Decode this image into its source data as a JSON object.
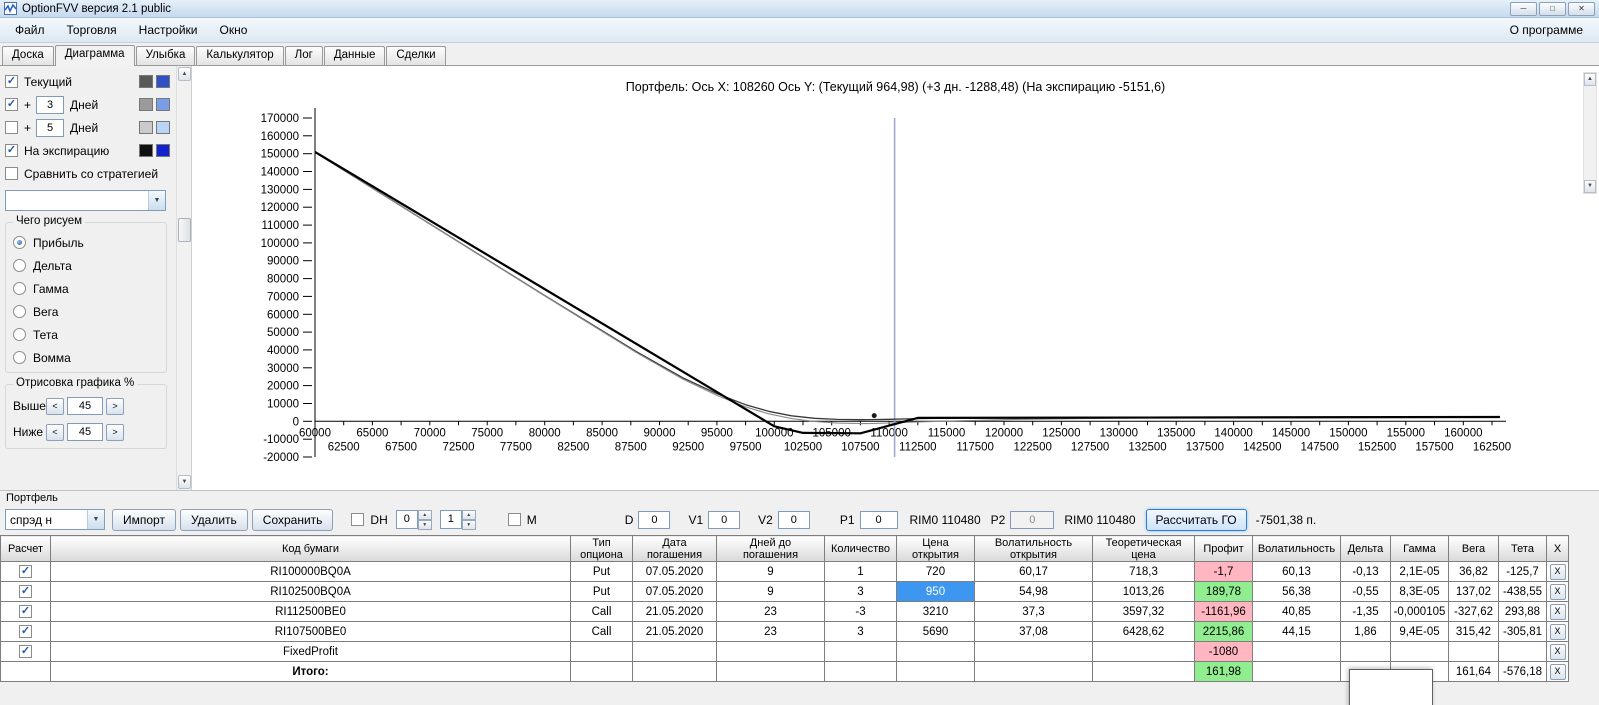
{
  "window": {
    "title": "OptionFVV версия 2.1 public",
    "buttons": {
      "minimize": "─",
      "maximize": "□",
      "close": "✕"
    }
  },
  "icons": {
    "up": "▲",
    "down": "▼",
    "dropdown": "▼"
  },
  "menu": {
    "items": [
      "Файл",
      "Торговля",
      "Настройки",
      "Окно"
    ],
    "right_item": "О программе"
  },
  "tabs": {
    "items": [
      "Доска",
      "Диаграмма",
      "Улыбка",
      "Калькулятор",
      "Лог",
      "Данные",
      "Сделки"
    ],
    "active_index": 1
  },
  "left_panel": {
    "series_rows": [
      {
        "label": "Текущий",
        "checked": true,
        "swatches": [
          "#595959",
          "#3050c8"
        ]
      },
      {
        "prefix": "+",
        "value": "3",
        "label": "Дней",
        "checked": true,
        "swatches": [
          "#9b9b9b",
          "#7a9de8"
        ]
      },
      {
        "prefix": "+",
        "value": "5",
        "label": "Дней",
        "checked": false,
        "swatches": [
          "#cacaca",
          "#b9d4f8"
        ]
      },
      {
        "label": "На экспирацию",
        "checked": true,
        "swatches": [
          "#101010",
          "#1322cf"
        ]
      }
    ],
    "compare_label": "Сравнить со стратегией",
    "compare_checked": false,
    "strategy_value": "",
    "draw_group": {
      "title": "Чего рисуем",
      "options": [
        "Прибыль",
        "Дельта",
        "Гамма",
        "Вега",
        "Тета",
        "Вомма"
      ],
      "selected": "Прибыль"
    },
    "render_group": {
      "title": "Отрисовка графика %",
      "rows": [
        {
          "label": "Выше",
          "value": "45"
        },
        {
          "label": "Ниже",
          "value": "45"
        }
      ],
      "dec_label": "<",
      "inc_label": ">"
    }
  },
  "chart": {
    "title": "Портфель: Ось X: 108260 Ось Y:  (Текущий 964,98)  (+3 дн. -1288,48)  (На экспирацию -5151,6)"
  },
  "chart_data": {
    "type": "line",
    "title": "Портфель",
    "xlabel": "",
    "ylabel": "",
    "xlim": [
      60000,
      163200
    ],
    "ylim": [
      -20000,
      170000
    ],
    "grid": false,
    "y_ticks": [
      170000,
      160000,
      150000,
      140000,
      130000,
      120000,
      110000,
      100000,
      90000,
      80000,
      70000,
      60000,
      50000,
      40000,
      30000,
      20000,
      10000,
      0,
      -10000,
      -20000
    ],
    "x_ticks_row1": [
      60000,
      65000,
      70000,
      75000,
      80000,
      85000,
      90000,
      95000,
      100000,
      105000,
      110000,
      115000,
      120000,
      125000,
      130000,
      135000,
      140000,
      145000,
      150000,
      155000,
      160000
    ],
    "x_ticks_row2": [
      62500,
      67500,
      72500,
      77500,
      82500,
      87500,
      92500,
      97500,
      102500,
      107500,
      112500,
      117500,
      122500,
      127500,
      132500,
      137500,
      142500,
      147500,
      152500,
      157500,
      162500
    ],
    "marker_x": 110480,
    "cursor_point": [
      108700,
      3200
    ],
    "readout": {
      "x": 108260,
      "current": "964,98",
      "plus3": "-1288,48",
      "expiration": "-5151,6"
    },
    "series": [
      {
        "name": "Текущий",
        "color": "#3a3a3a",
        "width": 1.3,
        "points": [
          [
            60000,
            150800
          ],
          [
            80000,
            70500
          ],
          [
            88000,
            39000
          ],
          [
            92000,
            24500
          ],
          [
            95000,
            15500
          ],
          [
            97500,
            9300
          ],
          [
            99500,
            5600
          ],
          [
            101500,
            3100
          ],
          [
            103500,
            1700
          ],
          [
            105500,
            1050
          ],
          [
            107500,
            900
          ],
          [
            108260,
            965
          ],
          [
            110000,
            1150
          ],
          [
            112500,
            1500
          ],
          [
            116000,
            1850
          ],
          [
            121000,
            2100
          ],
          [
            130000,
            2300
          ],
          [
            145000,
            2400
          ],
          [
            163200,
            2450
          ]
        ]
      },
      {
        "name": "+3 дн.",
        "color": "#8a8a8a",
        "width": 1.1,
        "points": [
          [
            60000,
            150900
          ],
          [
            80000,
            70300
          ],
          [
            88000,
            38500
          ],
          [
            92000,
            23800
          ],
          [
            95000,
            14500
          ],
          [
            97500,
            8100
          ],
          [
            99500,
            4200
          ],
          [
            101500,
            1500
          ],
          [
            103500,
            -100
          ],
          [
            105500,
            -1000
          ],
          [
            107500,
            -1300
          ],
          [
            108260,
            -1288
          ],
          [
            110000,
            -950
          ],
          [
            112500,
            -400
          ],
          [
            116000,
            300
          ],
          [
            121000,
            1100
          ],
          [
            130000,
            1800
          ],
          [
            145000,
            2200
          ],
          [
            163200,
            2350
          ]
        ]
      },
      {
        "name": "На экспирацию",
        "color": "#000000",
        "width": 2.2,
        "points": [
          [
            60000,
            151000
          ],
          [
            100000,
            -2800
          ],
          [
            102500,
            -6500
          ],
          [
            107500,
            -6700
          ],
          [
            112500,
            1900
          ],
          [
            163200,
            2400
          ]
        ]
      }
    ]
  },
  "portfolio": {
    "section_label": "Портфель",
    "combo_value": "спрэд н",
    "import_label": "Импорт",
    "delete_label": "Удалить",
    "save_label": "Сохранить",
    "dh_label": "DH",
    "spin_values": [
      "0",
      "1"
    ],
    "m_label": "M",
    "fields": [
      {
        "label": "D",
        "value": "0"
      },
      {
        "label": "V1",
        "value": "0"
      },
      {
        "label": "V2",
        "value": "0"
      },
      {
        "label": "P1",
        "value": "0"
      }
    ],
    "rim_label_1": "RIM0 110480",
    "p2_label": "P2",
    "p2_value": "0",
    "rim_label_2": "RIM0 110480",
    "calc_button": "Рассчитать ГО",
    "go_value": "-7501,38 п."
  },
  "table": {
    "headers": [
      "Расчет",
      "Код бумаги",
      "Тип\nопциона",
      "Дата\nпогашения",
      "Дней до\nпогашения",
      "Количество",
      "Цена\nоткрытия",
      "Волатильность\nоткрытия",
      "Теоретическая\nцена",
      "Профит",
      "Волатильность",
      "Дельта",
      "Гамма",
      "Вега",
      "Тета",
      "X"
    ],
    "delete_label": "X",
    "rows": [
      {
        "checked": true,
        "code": "RI100000BQ0A",
        "type": "Put",
        "date": "07.05.2020",
        "days": "9",
        "qty": "1",
        "price": "720",
        "vol_open": "60,17",
        "theor": "718,3",
        "profit": "-1,7",
        "profit_state": "neg",
        "vol": "60,13",
        "delta": "-0,13",
        "gamma": "2,1E-05",
        "vega": "36,82",
        "theta": "-125,7"
      },
      {
        "checked": true,
        "code": "RI102500BQ0A",
        "type": "Put",
        "date": "07.05.2020",
        "days": "9",
        "qty": "3",
        "price": "950",
        "price_selected": true,
        "vol_open": "54,98",
        "theor": "1013,26",
        "profit": "189,78",
        "profit_state": "pos",
        "vol": "56,38",
        "delta": "-0,55",
        "gamma": "8,3E-05",
        "vega": "137,02",
        "theta": "-438,55"
      },
      {
        "checked": true,
        "code": "RI112500BE0",
        "type": "Call",
        "date": "21.05.2020",
        "days": "23",
        "qty": "-3",
        "price": "3210",
        "vol_open": "37,3",
        "theor": "3597,32",
        "profit": "-1161,96",
        "profit_state": "neg",
        "vol": "40,85",
        "delta": "-1,35",
        "gamma": "-0,000105",
        "vega": "-327,62",
        "theta": "293,88"
      },
      {
        "checked": true,
        "code": "RI107500BE0",
        "type": "Call",
        "date": "21.05.2020",
        "days": "23",
        "qty": "3",
        "price": "5690",
        "vol_open": "37,08",
        "theor": "6428,62",
        "profit": "2215,86",
        "profit_state": "pos",
        "vol": "44,15",
        "delta": "1,86",
        "gamma": "9,4E-05",
        "vega": "315,42",
        "theta": "-305,81"
      },
      {
        "checked": true,
        "code": "FixedProfit",
        "type": "",
        "date": "",
        "days": "",
        "qty": "",
        "price": "",
        "vol_open": "",
        "theor": "",
        "profit": "-1080",
        "profit_state": "neg",
        "vol": "",
        "delta": "",
        "gamma": "",
        "vega": "",
        "theta": ""
      }
    ],
    "total_row": {
      "code": "Итого:",
      "profit": "161,98",
      "profit_state": "pos",
      "vega": "161,64",
      "theta": "-576,18"
    }
  },
  "colors": {
    "profit_positive": "#90ee90",
    "profit_negative": "#ffb6c1",
    "selected_cell": "#3d96f0",
    "marker_line": "#a0a8cc"
  }
}
